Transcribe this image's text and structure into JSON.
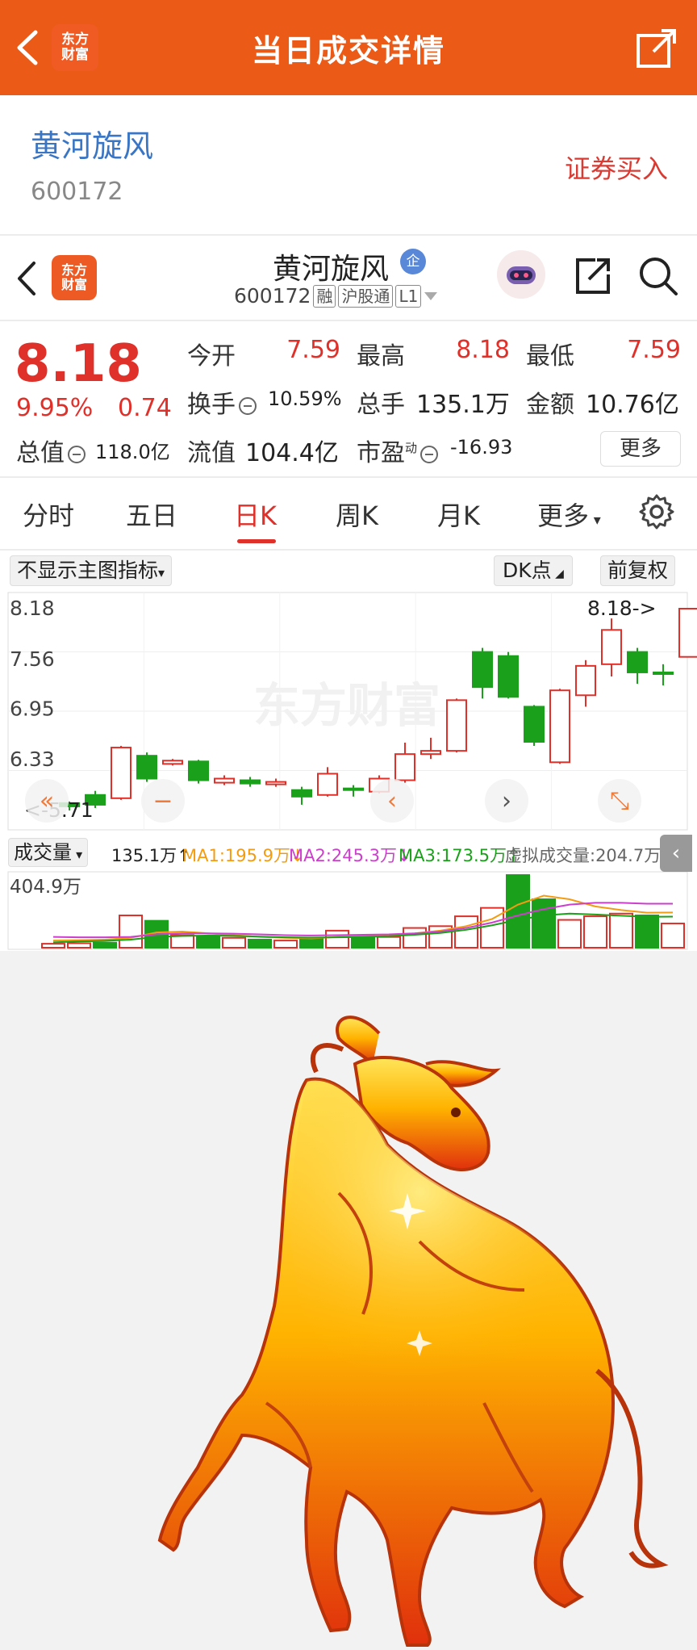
{
  "topbar": {
    "title": "当日成交详情",
    "logo_line1": "东方",
    "logo_line2": "财富"
  },
  "stock_header": {
    "name": "黄河旋风",
    "code": "600172",
    "buy_label": "证券买入"
  },
  "nav": {
    "name": "黄河旋风",
    "qi_badge": "企",
    "code": "600172",
    "tag_rong": "融",
    "tag_hgt": "沪股通",
    "tag_level": "L1",
    "logo_line1": "东方",
    "logo_line2": "财富"
  },
  "quote": {
    "price": "8.18",
    "change_pct": "9.95%",
    "change": "0.74",
    "open_label": "今开",
    "open": "7.59",
    "high_label": "最高",
    "high": "8.18",
    "low_label": "最低",
    "low": "7.59",
    "turnover_label": "换手",
    "turnover": "10.59%",
    "volume_label": "总手",
    "volume": "135.1万",
    "amount_label": "金额",
    "amount": "10.76亿",
    "mktcap_label": "总值",
    "mktcap": "118.0亿",
    "float_label": "流值",
    "float_cap": "104.4亿",
    "pe_label": "市盈",
    "pe_sup": "动",
    "pe": "-16.93",
    "more_label": "更多"
  },
  "tabs": [
    "分时",
    "五日",
    "日K",
    "周K",
    "月K",
    "更多"
  ],
  "active_tab": "日K",
  "chart_controls": {
    "indicator": "不显示主图指标",
    "dk": "DK点",
    "fuquan": "前复权"
  },
  "chart_data": {
    "type": "candlestick",
    "y_ticks": [
      "8.18",
      "7.56",
      "6.95",
      "6.33"
    ],
    "ylim": [
      5.71,
      8.18
    ],
    "high_marker": "8.18->",
    "low_marker": "<-5.71",
    "watermark": "东方财富",
    "candles": [
      {
        "o": 5.8,
        "c": 5.76,
        "h": 5.82,
        "l": 5.71,
        "dir": "down"
      },
      {
        "o": 5.9,
        "c": 5.78,
        "h": 5.95,
        "l": 5.74,
        "dir": "down"
      },
      {
        "o": 5.86,
        "c": 6.48,
        "h": 6.5,
        "l": 5.84,
        "dir": "up"
      },
      {
        "o": 6.38,
        "c": 6.1,
        "h": 6.42,
        "l": 6.06,
        "dir": "down"
      },
      {
        "o": 6.28,
        "c": 6.32,
        "h": 6.34,
        "l": 6.26,
        "dir": "up"
      },
      {
        "o": 6.31,
        "c": 6.08,
        "h": 6.33,
        "l": 6.04,
        "dir": "down"
      },
      {
        "o": 6.05,
        "c": 6.1,
        "h": 6.14,
        "l": 6.02,
        "dir": "up"
      },
      {
        "o": 6.08,
        "c": 6.04,
        "h": 6.12,
        "l": 6.0,
        "dir": "down"
      },
      {
        "o": 6.03,
        "c": 6.06,
        "h": 6.1,
        "l": 6.0,
        "dir": "up"
      },
      {
        "o": 5.96,
        "c": 5.88,
        "h": 6.0,
        "l": 5.78,
        "dir": "down"
      },
      {
        "o": 5.9,
        "c": 6.16,
        "h": 6.24,
        "l": 5.88,
        "dir": "up"
      },
      {
        "o": 5.98,
        "c": 5.96,
        "h": 6.02,
        "l": 5.88,
        "dir": "down"
      },
      {
        "o": 5.94,
        "c": 6.1,
        "h": 6.14,
        "l": 5.92,
        "dir": "up"
      },
      {
        "o": 6.08,
        "c": 6.4,
        "h": 6.54,
        "l": 6.05,
        "dir": "up"
      },
      {
        "o": 6.4,
        "c": 6.44,
        "h": 6.6,
        "l": 6.34,
        "dir": "up"
      },
      {
        "o": 6.44,
        "c": 7.06,
        "h": 7.08,
        "l": 6.42,
        "dir": "up"
      },
      {
        "o": 7.65,
        "c": 7.22,
        "h": 7.7,
        "l": 7.08,
        "dir": "down"
      },
      {
        "o": 7.6,
        "c": 7.1,
        "h": 7.65,
        "l": 7.08,
        "dir": "down"
      },
      {
        "o": 6.98,
        "c": 6.55,
        "h": 7.0,
        "l": 6.5,
        "dir": "down"
      },
      {
        "o": 6.3,
        "c": 7.18,
        "h": 7.2,
        "l": 6.28,
        "dir": "up"
      },
      {
        "o": 7.12,
        "c": 7.48,
        "h": 7.55,
        "l": 6.98,
        "dir": "up"
      },
      {
        "o": 7.5,
        "c": 7.92,
        "h": 8.06,
        "l": 7.35,
        "dir": "up"
      },
      {
        "o": 7.65,
        "c": 7.4,
        "h": 7.7,
        "l": 7.26,
        "dir": "down"
      },
      {
        "o": 7.4,
        "c": 7.38,
        "h": 7.5,
        "l": 7.24,
        "dir": "down"
      },
      {
        "o": 7.59,
        "c": 8.18,
        "h": 8.18,
        "l": 7.59,
        "dir": "up"
      }
    ],
    "volume": {
      "selector": "成交量",
      "total": "135.1万↑",
      "ma1": "MA1:195.9万↓",
      "ma2": "MA2:245.3万↓",
      "ma3": "MA3:173.5万↑",
      "virtual": "虚拟成交量:204.7万",
      "max_label": "404.9万",
      "vmax": 404.9,
      "values": [
        22,
        25,
        28,
        180,
        150,
        70,
        60,
        55,
        45,
        40,
        50,
        95,
        65,
        60,
        110,
        120,
        175,
        222,
        404.9,
        270,
        155,
        175,
        190,
        180,
        135.1
      ],
      "dirs": [
        "up",
        "up",
        "down",
        "up",
        "down",
        "up",
        "down",
        "up",
        "down",
        "up",
        "down",
        "up",
        "down",
        "up",
        "up",
        "up",
        "up",
        "up",
        "down",
        "down",
        "up",
        "up",
        "up",
        "down",
        "up"
      ],
      "ma1_line": [
        40,
        42,
        45,
        55,
        85,
        90,
        80,
        70,
        60,
        55,
        52,
        60,
        65,
        70,
        80,
        95,
        120,
        160,
        240,
        290,
        270,
        230,
        210,
        195,
        196
      ],
      "ma2_line": [
        60,
        58,
        58,
        60,
        75,
        80,
        80,
        78,
        74,
        70,
        68,
        70,
        72,
        74,
        80,
        90,
        110,
        140,
        180,
        215,
        240,
        250,
        250,
        245,
        245
      ],
      "ma3_line": [
        30,
        35,
        38,
        45,
        60,
        65,
        68,
        66,
        62,
        58,
        56,
        58,
        60,
        64,
        72,
        82,
        100,
        125,
        155,
        180,
        190,
        185,
        178,
        172,
        173
      ]
    },
    "colors": {
      "up": "#e0302a",
      "down": "#1aa01a",
      "ma1": "#f39c12",
      "ma2": "#cc3fcc",
      "ma3": "#1aa01a"
    }
  },
  "chart_nav": [
    "«",
    "−",
    "‹",
    "›",
    "⤡"
  ]
}
